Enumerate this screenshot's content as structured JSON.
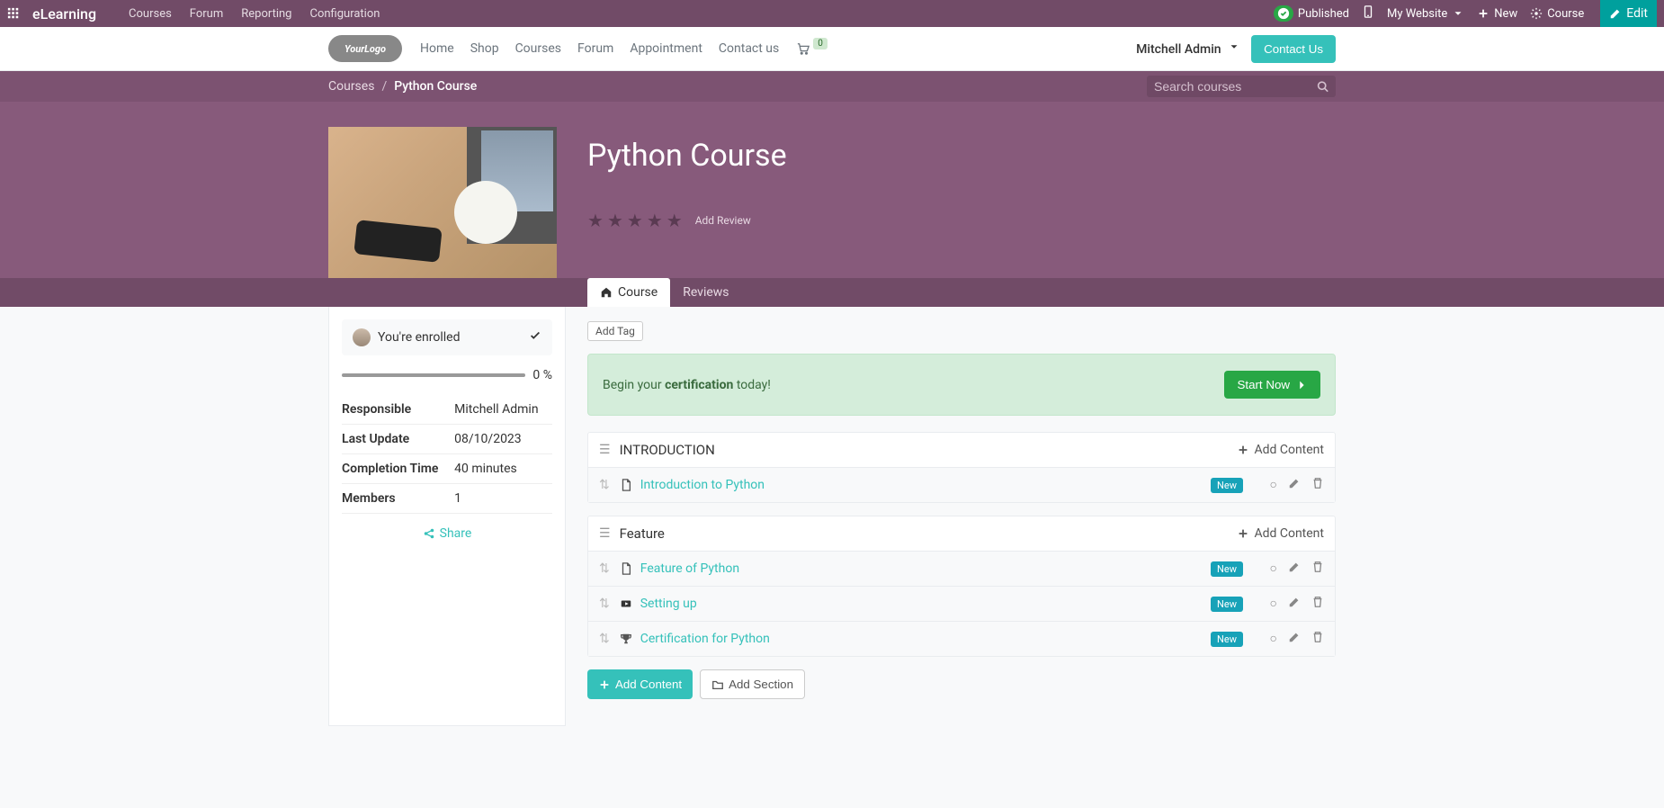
{
  "topbar": {
    "brand": "eLearning",
    "nav": [
      "Courses",
      "Forum",
      "Reporting",
      "Configuration"
    ],
    "published": "Published",
    "mywebsite": "My Website",
    "new": "New",
    "course": "Course",
    "edit": "Edit"
  },
  "siteheader": {
    "logo": "YourLogo",
    "nav": [
      "Home",
      "Shop",
      "Courses",
      "Forum",
      "Appointment",
      "Contact us"
    ],
    "cart_count": "0",
    "username": "Mitchell Admin",
    "contact": "Contact Us"
  },
  "breadcrumb": {
    "root": "Courses",
    "current": "Python Course"
  },
  "search": {
    "placeholder": "Search courses"
  },
  "course": {
    "title": "Python Course",
    "add_review": "Add Review",
    "tabs": {
      "course": "Course",
      "reviews": "Reviews"
    }
  },
  "sidebar": {
    "enrolled": "You're enrolled",
    "progress": "0 %",
    "meta": {
      "responsible_label": "Responsible",
      "responsible": "Mitchell Admin",
      "last_update_label": "Last Update",
      "last_update": "08/10/2023",
      "completion_label": "Completion Time",
      "completion": "40 minutes",
      "members_label": "Members",
      "members": "1"
    },
    "share": "Share"
  },
  "content": {
    "add_tag": "Add Tag",
    "cert_pre": "Begin your ",
    "cert_bold": "certification",
    "cert_post": " today!",
    "start_now": "Start Now",
    "add_content": "Add Content",
    "add_section": "Add Section",
    "sections": [
      {
        "title": "INTRODUCTION",
        "lessons": [
          {
            "icon": "pdf",
            "title": "Introduction to Python",
            "badge": "New"
          }
        ]
      },
      {
        "title": "Feature",
        "lessons": [
          {
            "icon": "pdf",
            "title": "Feature of Python",
            "badge": "New"
          },
          {
            "icon": "video",
            "title": "Setting up",
            "badge": "New"
          },
          {
            "icon": "trophy",
            "title": "Certification for Python",
            "badge": "New"
          }
        ]
      }
    ]
  }
}
